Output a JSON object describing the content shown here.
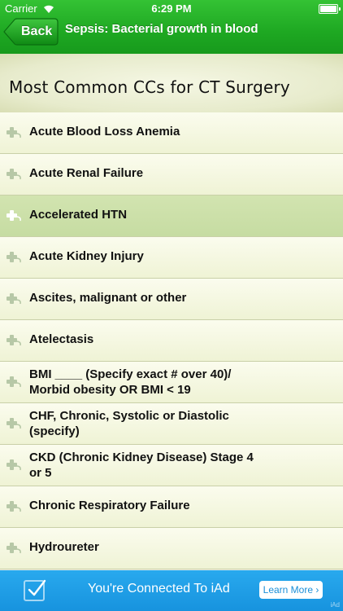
{
  "status_bar": {
    "carrier": "Carrier",
    "time": "6:29 PM"
  },
  "nav": {
    "back_label": "Back",
    "title": "Sepsis: Bacterial growth in blood"
  },
  "section": {
    "title": "Most Common CCs for CT Surgery"
  },
  "list": {
    "selected_index": 2,
    "items": [
      {
        "label": "Acute Blood Loss Anemia"
      },
      {
        "label": "Acute Renal Failure"
      },
      {
        "label": "Accelerated HTN"
      },
      {
        "label": "Acute Kidney Injury"
      },
      {
        "label": "Ascites, malignant or other"
      },
      {
        "label": "Atelectasis"
      },
      {
        "label": "BMI ____ (Specify exact # over 40)/ Morbid obesity OR BMI < 19"
      },
      {
        "label": "CHF, Chronic, Systolic or Diastolic (specify)"
      },
      {
        "label": "CKD (Chronic Kidney Disease) Stage 4 or 5"
      },
      {
        "label": "Chronic Respiratory Failure"
      },
      {
        "label": "Hydroureter"
      }
    ]
  },
  "ad_banner": {
    "text": "You're Connected To iAd",
    "button_label": "Learn More",
    "mark": "iAd"
  },
  "colors": {
    "nav_green": "#1ea822",
    "row_background": "#f4f7e0",
    "row_selected": "#c9dea6",
    "iad_blue": "#1e9be4"
  },
  "icons": {
    "row_icon": "plus-stethoscope-icon",
    "back_icon": "back-arrow-icon",
    "ad_icon": "checkmark-icon"
  }
}
